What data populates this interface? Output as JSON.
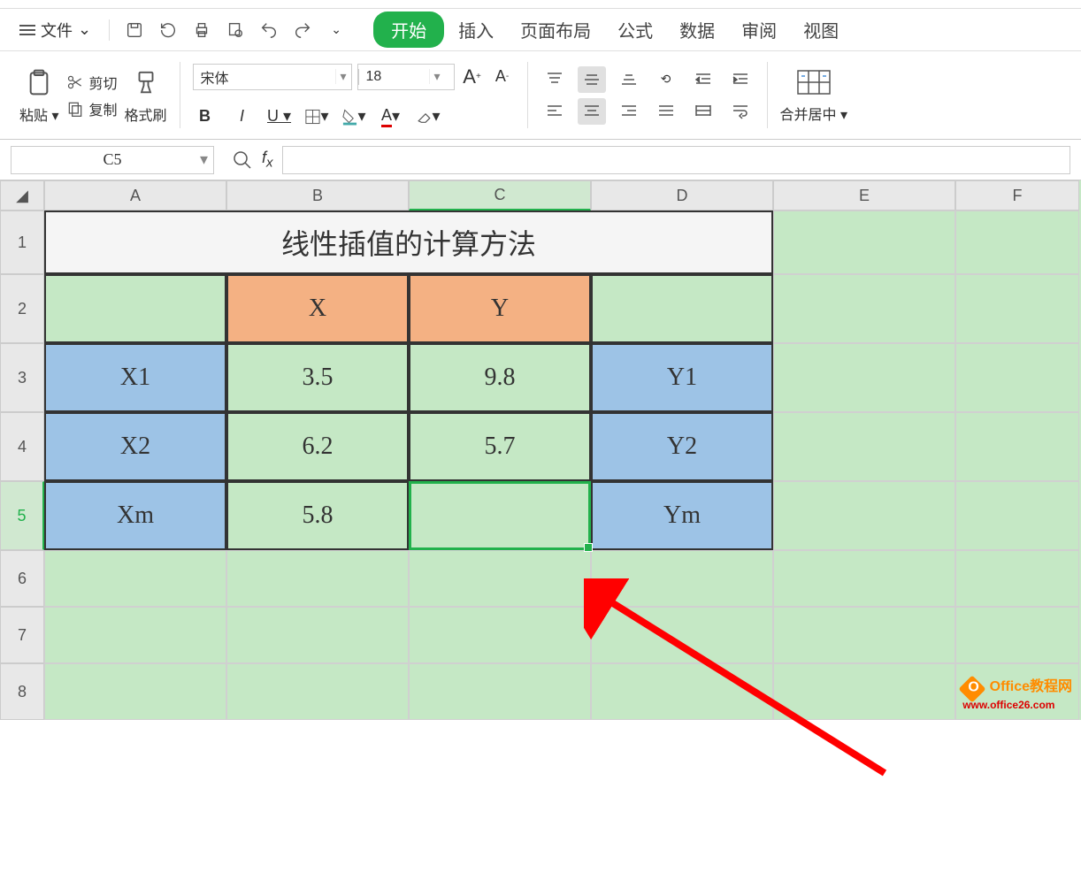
{
  "menu": {
    "file": "文件",
    "tabs": [
      "开始",
      "插入",
      "页面布局",
      "公式",
      "数据",
      "审阅",
      "视图"
    ]
  },
  "ribbon": {
    "paste": "粘贴",
    "cut": "剪切",
    "copy": "复制",
    "format_painter": "格式刷",
    "font_name": "宋体",
    "font_size": "18",
    "merge": "合并居中"
  },
  "namebox": "C5",
  "formula": "",
  "columns": [
    "A",
    "B",
    "C",
    "D",
    "E",
    "F"
  ],
  "rows": [
    "1",
    "2",
    "3",
    "4",
    "5",
    "6",
    "7",
    "8"
  ],
  "selected_col": "C",
  "selected_row": "5",
  "sheet": {
    "title": "线性插值的计算方法",
    "r2": {
      "a": "",
      "b": "X",
      "c": "Y",
      "d": ""
    },
    "r3": {
      "a": "X1",
      "b": "3.5",
      "c": "9.8",
      "d": "Y1"
    },
    "r4": {
      "a": "X2",
      "b": "6.2",
      "c": "5.7",
      "d": "Y2"
    },
    "r5": {
      "a": "Xm",
      "b": "5.8",
      "c": "",
      "d": "Ym"
    }
  },
  "watermark": {
    "line1": "Office教程网",
    "line2": "www.office26.com"
  }
}
